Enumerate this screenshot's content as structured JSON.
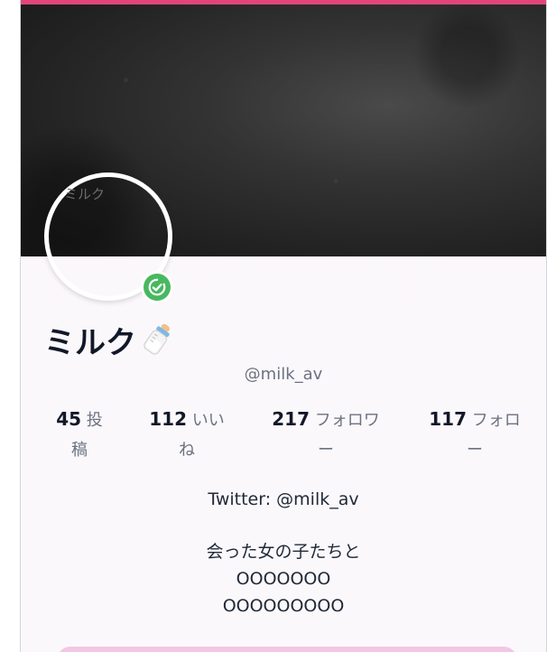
{
  "profile": {
    "avatar_alt": "ミルク",
    "name": "ミルク",
    "handle": "@milk_av"
  },
  "stats": {
    "posts": {
      "value": "45",
      "label_line1": "投",
      "label_line2": "稿"
    },
    "likes": {
      "value": "112",
      "label_line1": "いい",
      "label_line2": "ね"
    },
    "followers": {
      "value": "217",
      "label_line1": "フォロワ",
      "label_line2": "ー"
    },
    "following": {
      "value": "117",
      "label_line1": "フォロ",
      "label_line2": "ー"
    }
  },
  "bio": {
    "line1": "Twitter: @milk_av",
    "line2": "会った女の子たちと",
    "line3": "OOOOOOO",
    "line4": "OOOOOOOOO"
  },
  "colors": {
    "accent": "#e0467a",
    "verified": "#48b860"
  },
  "icons": {
    "verified": "check-circle-icon",
    "name_emoji": "baby-bottle-icon"
  }
}
